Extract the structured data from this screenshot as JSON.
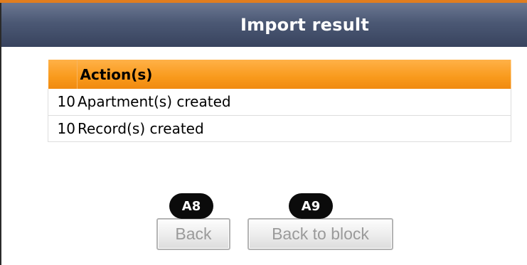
{
  "header": {
    "title": "Import result"
  },
  "table": {
    "columns": [
      "",
      "Action(s)"
    ],
    "rows": [
      {
        "count": "10",
        "description": "Apartment(s) created"
      },
      {
        "count": "10",
        "description": "Record(s) created"
      }
    ]
  },
  "buttons": {
    "back": "Back",
    "back_to_block": "Back to block"
  },
  "badges": {
    "back": "A8",
    "back_to_block": "A9"
  },
  "colors": {
    "header": "#4b5874",
    "table_header": "#f99a1c",
    "accent_line": "#e07d1f"
  }
}
